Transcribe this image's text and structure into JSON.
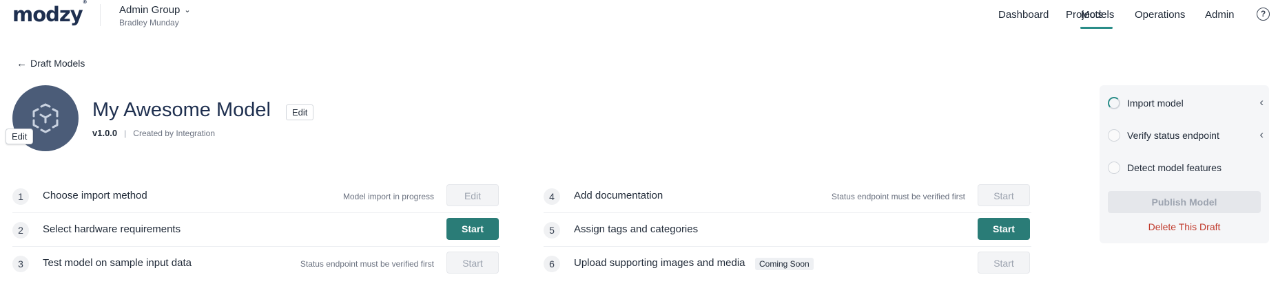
{
  "header": {
    "logo": "modzy",
    "logo_mark": "®",
    "group_name": "Admin Group",
    "group_user": "Bradley Munday",
    "nav": [
      "Dashboard",
      "Projects",
      "Models",
      "Operations",
      "Admin"
    ],
    "active_nav": "Models",
    "help_label": "?"
  },
  "back_link": "Draft Models",
  "model": {
    "title": "My Awesome Model",
    "edit_label": "Edit",
    "avatar_edit_label": "Edit",
    "version": "v1.0.0",
    "separator": "|",
    "created_by": "Created by Integration"
  },
  "steps": [
    {
      "num": "1",
      "label": "Choose import method",
      "note": "Model import in progress",
      "button": "Edit",
      "state": "disabled"
    },
    {
      "num": "2",
      "label": "Select hardware requirements",
      "note": "",
      "button": "Start",
      "state": "primary"
    },
    {
      "num": "3",
      "label": "Test model on sample input data",
      "note": "Status endpoint must be verified first",
      "button": "Start",
      "state": "disabled"
    },
    {
      "num": "4",
      "label": "Add documentation",
      "note": "Status endpoint must be verified first",
      "button": "Start",
      "state": "disabled"
    },
    {
      "num": "5",
      "label": "Assign tags and categories",
      "note": "",
      "button": "Start",
      "state": "primary"
    },
    {
      "num": "6",
      "label": "Upload supporting images and media",
      "badge": "Coming Soon",
      "button": "Start",
      "state": "disabled"
    }
  ],
  "panel": {
    "checks": [
      {
        "label": "Import model",
        "status": "in-progress"
      },
      {
        "label": "Verify status endpoint",
        "status": "pending"
      },
      {
        "label": "Detect model features",
        "status": "pending"
      }
    ],
    "publish_label": "Publish Model",
    "delete_label": "Delete This Draft"
  },
  "colors": {
    "brand": "#1e2f4f",
    "accent": "#2a8d88",
    "primary_button": "#2a7c77",
    "danger": "#c0392b"
  }
}
